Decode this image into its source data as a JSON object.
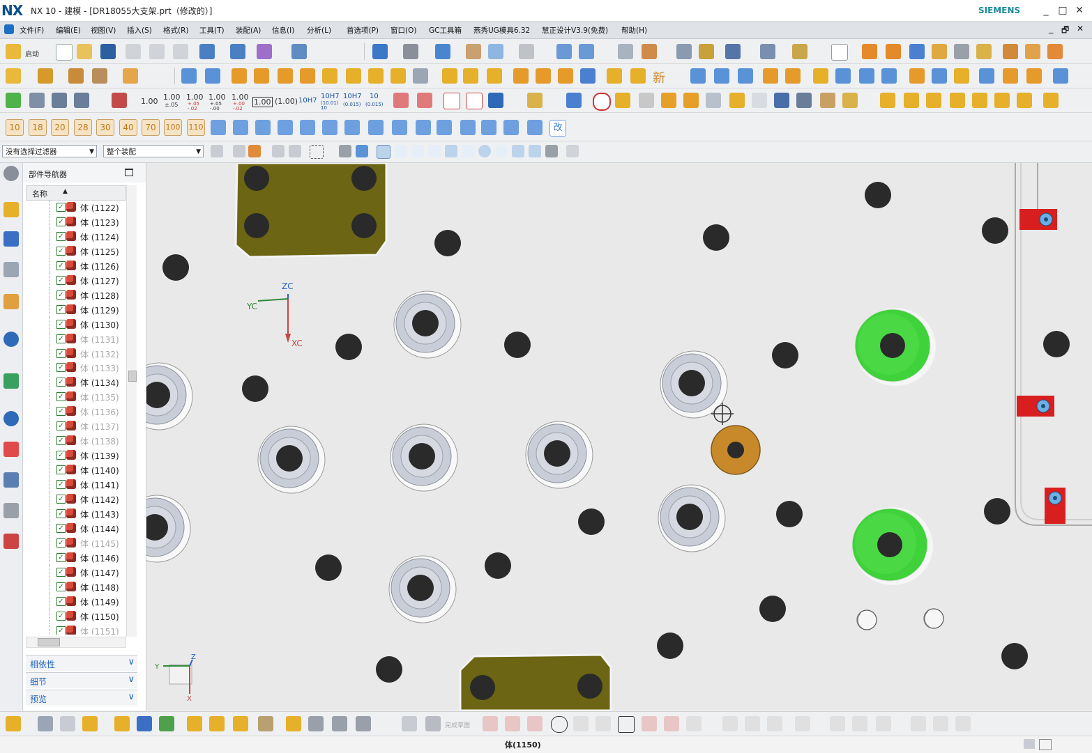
{
  "window": {
    "logo": "NX",
    "title": "NX 10 - 建模 - [DR18055大支架.prt（修改的）]",
    "brand": "SIEMENS",
    "controls": [
      "_",
      "□",
      "✕"
    ]
  },
  "menu": {
    "items": [
      "文件(F)",
      "编辑(E)",
      "视图(V)",
      "插入(S)",
      "格式(R)",
      "工具(T)",
      "装配(A)",
      "信息(I)",
      "分析(L)",
      "首选项(P)",
      "窗口(O)",
      "GC工具箱",
      "燕秀UG模具6.32",
      "慧正设计V3.9(免费)",
      "帮助(H)"
    ],
    "doc_controls": [
      "_",
      "🗗",
      "✕"
    ]
  },
  "toolbar1": {
    "start_label": "启动"
  },
  "toolbar3": {
    "dims": [
      "1.00",
      "1.00",
      "1.00",
      "1.00",
      "1.00",
      "1.00",
      "(1.00)",
      "10H7",
      "10H7",
      "10H7",
      "10"
    ],
    "dim_subs": [
      "",
      "±.05",
      "+.05\n-.02",
      "+.05\n-.00",
      "+.00\n-.02",
      "",
      "",
      "",
      "(10.01)\n10",
      "(0.015)",
      "(0.015)"
    ]
  },
  "toolbar4": {
    "numbers": [
      "10",
      "18",
      "20",
      "28",
      "30",
      "40",
      "70",
      "100",
      "110"
    ],
    "change_label": "改"
  },
  "toolbar2": {
    "new_label": "新"
  },
  "selection": {
    "filter": "没有选择过滤器",
    "scope": "整个装配"
  },
  "navigator": {
    "title": "部件导航器",
    "column_name": "名称",
    "rows": [
      {
        "label": "体 (1122)",
        "dim": false
      },
      {
        "label": "体 (1123)",
        "dim": false
      },
      {
        "label": "体 (1124)",
        "dim": false
      },
      {
        "label": "体 (1125)",
        "dim": false
      },
      {
        "label": "体 (1126)",
        "dim": false
      },
      {
        "label": "体 (1127)",
        "dim": false
      },
      {
        "label": "体 (1128)",
        "dim": false
      },
      {
        "label": "体 (1129)",
        "dim": false
      },
      {
        "label": "体 (1130)",
        "dim": false
      },
      {
        "label": "体 (1131)",
        "dim": true
      },
      {
        "label": "体 (1132)",
        "dim": true
      },
      {
        "label": "体 (1133)",
        "dim": true
      },
      {
        "label": "体 (1134)",
        "dim": false
      },
      {
        "label": "体 (1135)",
        "dim": true
      },
      {
        "label": "体 (1136)",
        "dim": true
      },
      {
        "label": "体 (1137)",
        "dim": true
      },
      {
        "label": "体 (1138)",
        "dim": true
      },
      {
        "label": "体 (1139)",
        "dim": false
      },
      {
        "label": "体 (1140)",
        "dim": false
      },
      {
        "label": "体 (1141)",
        "dim": false
      },
      {
        "label": "体 (1142)",
        "dim": false
      },
      {
        "label": "体 (1143)",
        "dim": false
      },
      {
        "label": "体 (1144)",
        "dim": false
      },
      {
        "label": "体 (1145)",
        "dim": true
      },
      {
        "label": "体 (1146)",
        "dim": false
      },
      {
        "label": "体 (1147)",
        "dim": false
      },
      {
        "label": "体 (1148)",
        "dim": false
      },
      {
        "label": "体 (1149)",
        "dim": false
      },
      {
        "label": "体 (1150)",
        "dim": false
      },
      {
        "label": "体 (1151)",
        "dim": true
      }
    ],
    "sections": [
      "相依性",
      "细节",
      "预览"
    ]
  },
  "graphics": {
    "axis_labels": {
      "zc": "ZC",
      "yc": "YC",
      "xc": "XC"
    },
    "triad_labels": {
      "y": "Y",
      "z": "Z",
      "x": "X"
    },
    "colors": {
      "background": "#e9e9e9",
      "olive_block": "#6b6514",
      "green_part": "#3fd23a",
      "orange_part": "#c8892a",
      "red_part": "#d81e1e",
      "hole": "#2a2a2a",
      "bushing": "#c9cdd8"
    }
  },
  "bottom": {
    "sketch_label": "完成草图"
  },
  "status": {
    "text": "体(1150)"
  }
}
